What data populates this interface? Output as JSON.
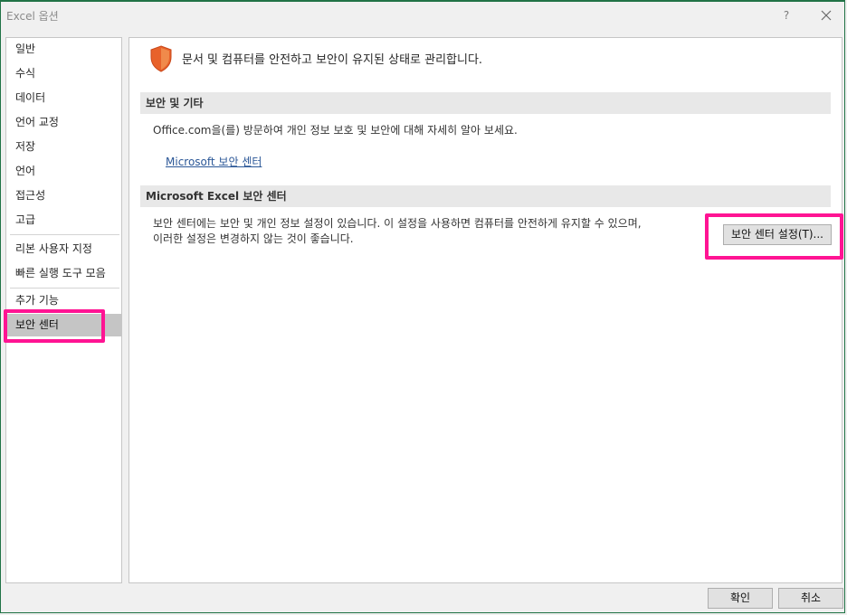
{
  "window": {
    "title": "Excel 옵션",
    "help_label": "?"
  },
  "sidebar": {
    "items": [
      {
        "label": "일반"
      },
      {
        "label": "수식"
      },
      {
        "label": "데이터"
      },
      {
        "label": "언어 교정"
      },
      {
        "label": "저장"
      },
      {
        "label": "언어"
      },
      {
        "label": "접근성"
      },
      {
        "label": "고급"
      },
      {
        "label": "리본 사용자 지정"
      },
      {
        "label": "빠른 실행 도구 모음"
      },
      {
        "label": "추가 기능"
      },
      {
        "label": "보안 센터"
      }
    ],
    "selected": "보안 센터"
  },
  "main": {
    "header_text": "문서 및 컴퓨터를 안전하고 보안이 유지된 상태로 관리합니다.",
    "header_icon": "shield-icon",
    "section1": {
      "title": "보안 및 기타",
      "text": "Office.com을(를) 방문하여 개인 정보 보호 및 보안에 대해 자세히 알아 보세요.",
      "link": "Microsoft 보안 센터"
    },
    "section2": {
      "title": "Microsoft Excel 보안 센터",
      "text_line1": "보안 센터에는 보안 및 개인 정보 설정이 있습니다. 이 설정을 사용하면 컴퓨터를 안전하게 유지할 수 있으며,",
      "text_line2": "이러한 설정은 변경하지 않는 것이 좋습니다.",
      "button": "보안 센터 설정(T)..."
    }
  },
  "footer": {
    "ok_label": "확인",
    "cancel_label": "취소"
  },
  "colors": {
    "highlight": "#ff1493",
    "shield_orange": "#e8622a",
    "link": "#2b5797",
    "selected_nav": "#c5c5c5"
  }
}
